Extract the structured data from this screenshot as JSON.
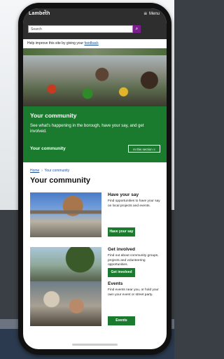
{
  "header": {
    "logo_text": "Lambeth",
    "menu_label": "Menu",
    "menu_icon": "menu-icon"
  },
  "search": {
    "placeholder": "Search"
  },
  "feedback": {
    "text": "Help improve this site by giving your ",
    "link": "feedback"
  },
  "hero": {
    "heading": "Your community",
    "description": "See what's happening in the borough, have your say, and get involved.",
    "section_label": "Your community",
    "in_section_button": "In this section"
  },
  "breadcrumb": {
    "home": "Home",
    "current": "Your community"
  },
  "page_title": "Your community",
  "cards": [
    {
      "title": "Have your say",
      "text": "Find opportunities to have your say on local projects and events.",
      "button": "Have your say"
    },
    {
      "title": "Get involved",
      "text": "Find out about community groups, projects and volunteering opportunities.",
      "button": "Get involved"
    },
    {
      "title": "Events",
      "text": "Find events near you, or hold your own your event or street party.",
      "button": "Events"
    }
  ],
  "colors": {
    "header": "#2e2e2e",
    "brand_green": "#1a7a2e",
    "search_purple": "#7a1f8c",
    "link_blue": "#1a4f9c"
  }
}
